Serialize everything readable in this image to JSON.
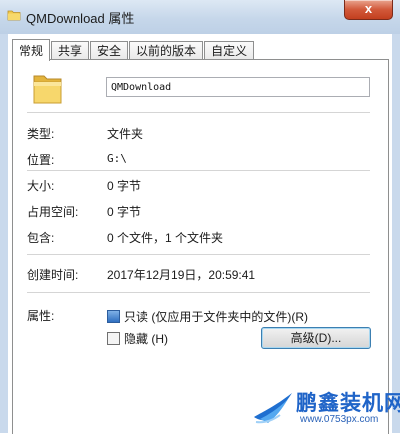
{
  "window": {
    "title": "QMDownload 属性",
    "close_label": "x",
    "icon": "folder-icon"
  },
  "tabs": [
    {
      "label": "常规",
      "active": true
    },
    {
      "label": "共享",
      "active": false
    },
    {
      "label": "安全",
      "active": false
    },
    {
      "label": "以前的版本",
      "active": false
    },
    {
      "label": "自定义",
      "active": false
    }
  ],
  "general": {
    "name_value": "QMDownload",
    "rows": {
      "type": {
        "label": "类型:",
        "value": "文件夹"
      },
      "location": {
        "label": "位置:",
        "value": "G:\\"
      },
      "size": {
        "label": "大小:",
        "value": "0 字节"
      },
      "size_on_disk": {
        "label": "占用空间:",
        "value": "0 字节"
      },
      "contains": {
        "label": "包含:",
        "value": "0 个文件，1 个文件夹"
      },
      "created": {
        "label": "创建时间:",
        "value": "2017年12月19日，20:59:41"
      }
    },
    "attributes": {
      "label": "属性:",
      "readonly": {
        "label": "只读 (仅应用于文件夹中的文件)(R)",
        "checked": true
      },
      "hidden": {
        "label": "隐藏 (H)",
        "checked": false
      },
      "advanced_button": "高级(D)..."
    }
  },
  "watermark": {
    "brand": "鹏鑫装机网",
    "url": "www.0753px.com"
  },
  "colors": {
    "titlebar": "#c6d7ea",
    "close_button": "#c94626",
    "accent_blue": "#1f64c8",
    "folder_yellow": "#f2c94c"
  }
}
